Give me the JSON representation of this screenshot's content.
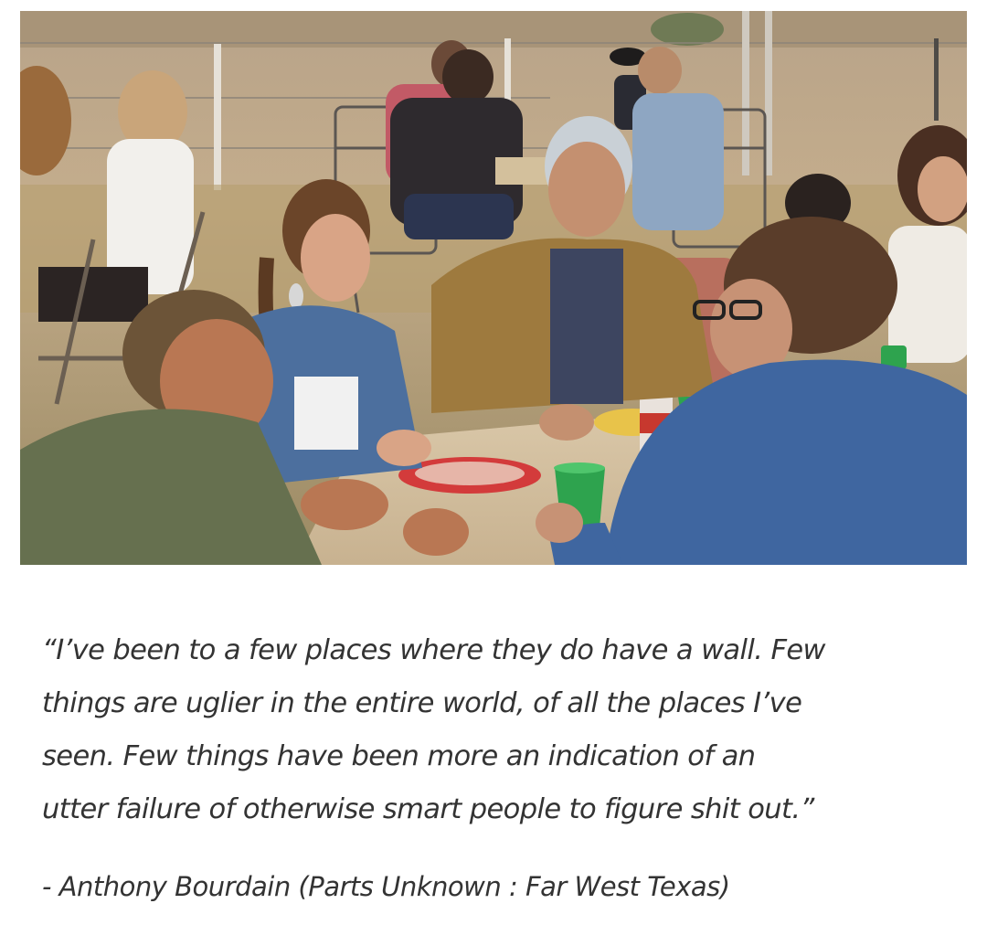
{
  "quote": {
    "lines": [
      "“I’ve been to a few places where they do have a wall. Few",
      "things are uglier in the entire world, of all the places I’ve",
      "seen. Few things have been more an indication of an",
      "utter failure of otherwise smart people to figure shit out.”"
    ]
  },
  "attribution": "- Anthony Bourdain (Parts Unknown : Far West Texas)",
  "colors": {
    "text": "#333333",
    "background": "#ffffff"
  }
}
